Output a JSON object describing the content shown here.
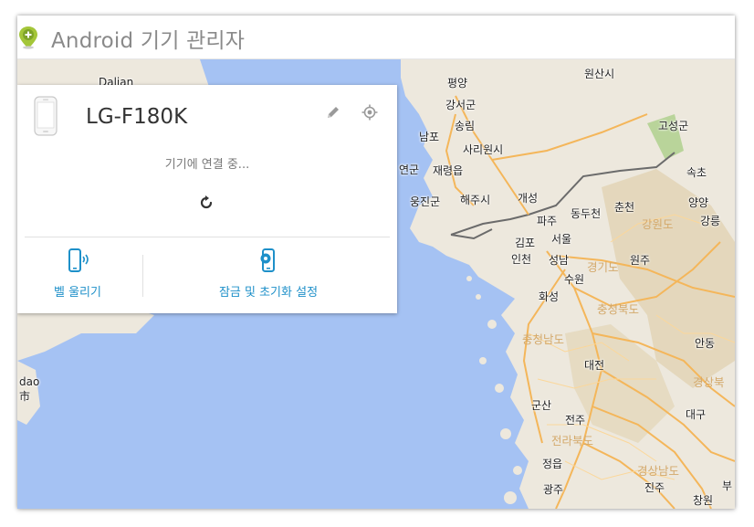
{
  "header": {
    "title": "Android 기기 관리자",
    "logo_icon": "android-device-manager-logo-icon"
  },
  "device": {
    "name": "LG-F180K",
    "status": "기기에 연결 중...",
    "icons": [
      "phone-icon",
      "pencil-icon",
      "location-target-icon",
      "refresh-icon"
    ]
  },
  "actions": {
    "ring_label": "벨 울리기",
    "lock_label": "잠금 및 초기화 설정"
  },
  "map": {
    "labels": [
      "원산시",
      "평양",
      "강서군",
      "송림",
      "사리원시",
      "남포",
      "재령읍",
      "연군",
      "웅진군",
      "해주시",
      "개성",
      "파주",
      "동두천",
      "춘천",
      "양양",
      "강원도",
      "강릉",
      "김포",
      "서울",
      "인천",
      "성남",
      "경기도",
      "원주",
      "수원",
      "화성",
      "충청북도",
      "충청남도",
      "안동",
      "대전",
      "경상북",
      "군산",
      "전주",
      "대구",
      "전라북도",
      "정읍",
      "경상남도",
      "광주",
      "진주",
      "창원",
      "고성군",
      "속초",
      "Dalian",
      "dao",
      "市",
      "부"
    ]
  },
  "colors": {
    "sea": "#a5c2f3",
    "land": "#ede8dd",
    "accent": "#1e90c9",
    "road": "#f4b65a",
    "border": "#6b6b6b"
  }
}
